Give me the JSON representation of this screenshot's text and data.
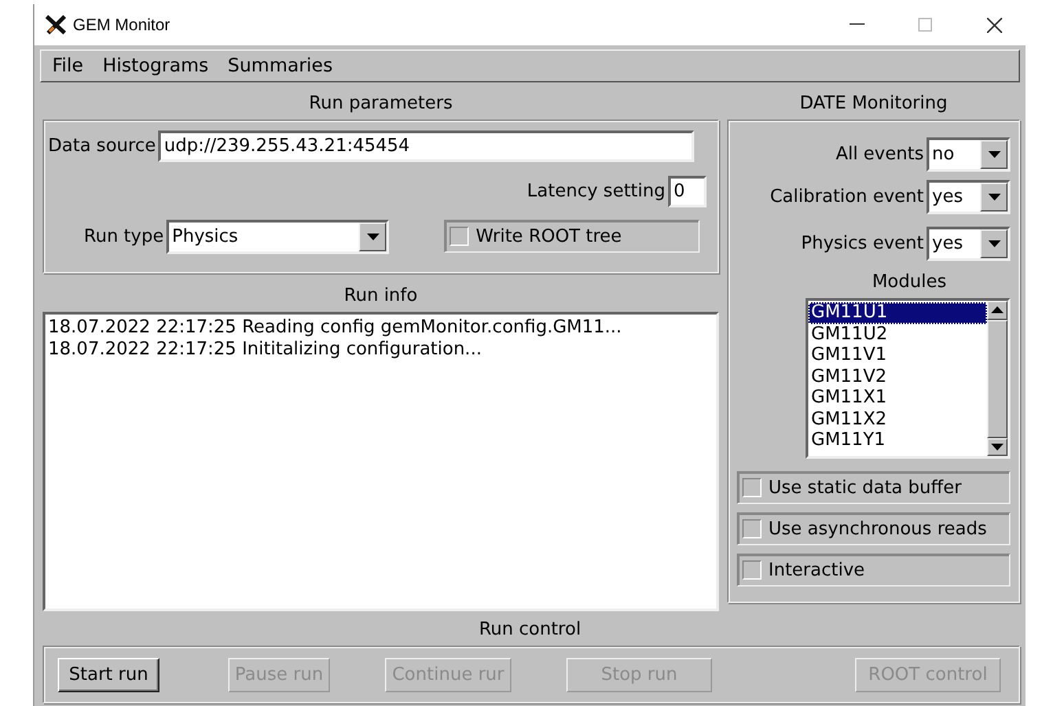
{
  "window": {
    "title": "GEM Monitor"
  },
  "menu": [
    "File",
    "Histograms",
    "Summaries"
  ],
  "run_parameters": {
    "title": "Run parameters",
    "data_source": {
      "label": "Data source",
      "value": "udp://239.255.43.21:45454"
    },
    "latency": {
      "label": "Latency setting",
      "value": "0"
    },
    "run_type": {
      "label": "Run type",
      "value": "Physics"
    },
    "write_root_tree": {
      "label": "Write ROOT tree",
      "checked": false
    }
  },
  "run_info": {
    "title": "Run info",
    "lines": [
      "18.07.2022 22:17:25 Reading config gemMonitor.config.GM11...",
      "18.07.2022 22:17:25 Inititalizing configuration..."
    ]
  },
  "date_monitoring": {
    "title": "DATE Monitoring",
    "selects": [
      {
        "label": "All events",
        "value": "no"
      },
      {
        "label": "Calibration event",
        "value": "yes"
      },
      {
        "label": "Physics event",
        "value": "yes"
      }
    ],
    "modules_title": "Modules",
    "modules": [
      {
        "label": "GM11U1",
        "selected": true
      },
      {
        "label": "GM11U2",
        "selected": false
      },
      {
        "label": "GM11V1",
        "selected": false
      },
      {
        "label": "GM11V2",
        "selected": false
      },
      {
        "label": "GM11X1",
        "selected": false
      },
      {
        "label": "GM11X2",
        "selected": false
      },
      {
        "label": "GM11Y1",
        "selected": false
      }
    ],
    "options": [
      {
        "label": "Use static data buffer",
        "checked": false
      },
      {
        "label": "Use asynchronous reads",
        "checked": false
      },
      {
        "label": "Interactive",
        "checked": false
      }
    ]
  },
  "run_control": {
    "title": "Run control",
    "buttons": [
      {
        "label": "Start run",
        "disabled": false
      },
      {
        "label": "Pause run",
        "disabled": true
      },
      {
        "label": "Continue rur",
        "disabled": true
      },
      {
        "label": "Stop run",
        "disabled": true
      },
      {
        "label": "ROOT control",
        "disabled": true
      }
    ]
  }
}
